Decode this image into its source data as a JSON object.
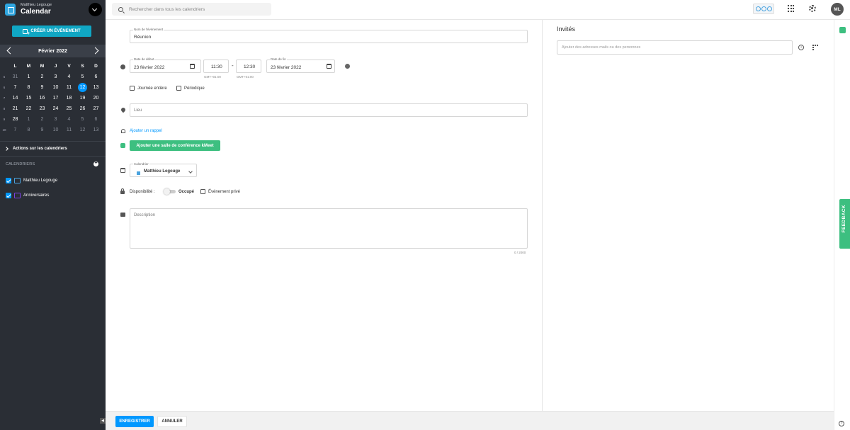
{
  "app": {
    "user_name": "Matthieu Legouge",
    "title": "Calendar"
  },
  "sidebar": {
    "create_button": "CRÉER UN ÉVÉNEMENT",
    "calendar": {
      "month_label": "Février  2022",
      "weekdays": [
        "L",
        "M",
        "M",
        "J",
        "V",
        "S",
        "D"
      ],
      "weeks": [
        {
          "num": "5",
          "days": [
            "31",
            "1",
            "2",
            "3",
            "4",
            "5",
            "6"
          ],
          "muted": [
            true,
            false,
            false,
            false,
            false,
            false,
            false
          ]
        },
        {
          "num": "6",
          "days": [
            "7",
            "8",
            "9",
            "10",
            "11",
            "12",
            "13"
          ],
          "muted": [
            false,
            false,
            false,
            false,
            false,
            false,
            false
          ]
        },
        {
          "num": "7",
          "days": [
            "14",
            "15",
            "16",
            "17",
            "18",
            "19",
            "20"
          ],
          "muted": [
            false,
            false,
            false,
            false,
            false,
            false,
            false
          ]
        },
        {
          "num": "8",
          "days": [
            "21",
            "22",
            "23",
            "24",
            "25",
            "26",
            "27"
          ],
          "muted": [
            false,
            false,
            false,
            false,
            false,
            false,
            false
          ]
        },
        {
          "num": "9",
          "days": [
            "28",
            "1",
            "2",
            "3",
            "4",
            "5",
            "6"
          ],
          "muted": [
            false,
            true,
            true,
            true,
            true,
            true,
            true
          ]
        },
        {
          "num": "10",
          "days": [
            "7",
            "8",
            "9",
            "10",
            "11",
            "12",
            "13"
          ],
          "muted": [
            true,
            true,
            true,
            true,
            true,
            true,
            true
          ]
        }
      ],
      "today": "12"
    },
    "actions_label": "Actions sur les calendriers",
    "calendars_heading": "CALENDRIERS",
    "calendars": [
      {
        "name": "Matthieu Legouge",
        "color": "#4aa3df"
      },
      {
        "name": "Anniversaires",
        "color": "#7b3fe4"
      }
    ]
  },
  "topbar": {
    "search_placeholder": "Rechercher dans tous les calendriers",
    "avatar_initials": "ML"
  },
  "form": {
    "event_name_label": "Nom de l'événement",
    "event_name_value": "Réunion",
    "start_date_label": "Date de début",
    "start_date_value": "23 février 2022",
    "start_time_value": "11:30",
    "start_tz": "GMT+01:00",
    "time_separator": "-",
    "end_time_value": "12:30",
    "end_tz": "GMT+01:00",
    "end_date_label": "Date de fin",
    "end_date_value": "23 février 2022",
    "all_day_label": "Journée entière",
    "recurring_label": "Périodique",
    "location_placeholder": "Lieu",
    "add_reminder_label": "Ajouter un rappel",
    "kmeet_button_label": "Ajouter une salle de conférence kMeet",
    "calendar_label": "Calendrier",
    "calendar_value": "Matthieu Legouge",
    "calendar_color": "#4aa3df",
    "availability_label": "Disponibilité :",
    "availability_value": "Occupé",
    "private_label": "Événement privé",
    "description_placeholder": "Description",
    "description_counter": "0 / 2000"
  },
  "guests": {
    "title": "Invités",
    "input_placeholder": "Ajouter des adresses mails ou des personnes"
  },
  "right_rail": {
    "feedback_label": "FEEDBACK"
  },
  "footer": {
    "save_label": "ENREGISTRER",
    "cancel_label": "ANNULER"
  }
}
